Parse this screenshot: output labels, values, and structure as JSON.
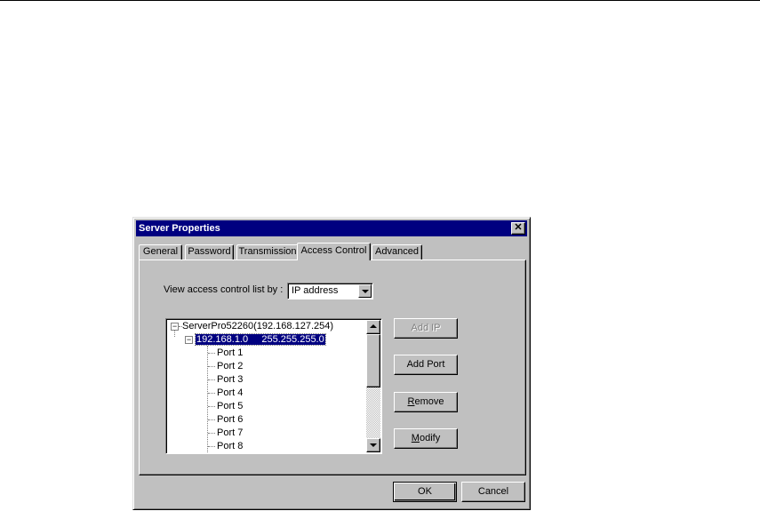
{
  "dialog": {
    "title": "Server Properties",
    "close_glyph": "✕"
  },
  "tabs": [
    {
      "label": "General",
      "active": false
    },
    {
      "label": "Password",
      "active": false
    },
    {
      "label": "Transmission",
      "active": false
    },
    {
      "label": "Access Control",
      "active": true
    },
    {
      "label": "Advanced",
      "active": false
    }
  ],
  "access_control": {
    "view_label": "View access control list by :",
    "view_by_value": "IP address",
    "tree": {
      "root": {
        "label": "ServerPro52260(192.168.127.254)",
        "expanded": true
      },
      "ip_node": {
        "label": "192.168.1.0     255.255.255.0",
        "expanded": true,
        "selected": true
      },
      "ports": [
        "Port 1",
        "Port 2",
        "Port 3",
        "Port 4",
        "Port 5",
        "Port 6",
        "Port 7",
        "Port 8"
      ]
    },
    "buttons": {
      "add_ip": {
        "label": "Add IP",
        "enabled": false
      },
      "add_port": {
        "label": "Add Port",
        "enabled": true
      },
      "remove": {
        "pre": "",
        "mnemonic": "R",
        "post": "emove",
        "enabled": true
      },
      "modify": {
        "pre": "",
        "mnemonic": "M",
        "post": "odify",
        "enabled": true
      }
    }
  },
  "footer": {
    "ok_label": "OK",
    "cancel_label": "Cancel"
  },
  "icons": {
    "expander_expanded": "⊟"
  }
}
